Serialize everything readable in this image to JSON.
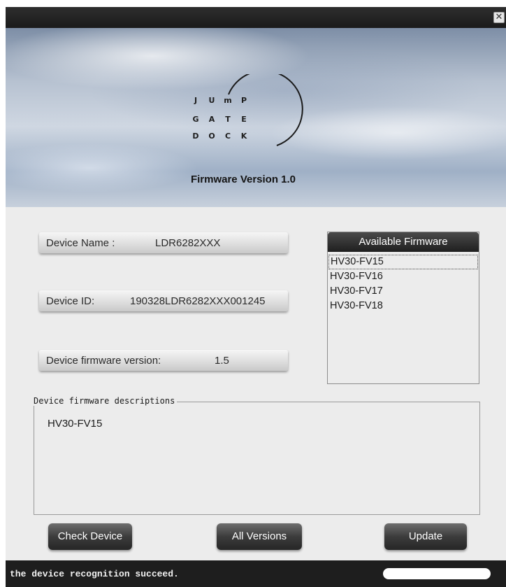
{
  "window": {
    "close_glyph": "✕"
  },
  "banner": {
    "logo_letters": [
      [
        "J",
        "U",
        "m",
        "P"
      ],
      [
        "G",
        "A",
        "T",
        "E"
      ],
      [
        "D",
        "O",
        "C",
        "K"
      ]
    ],
    "firmware_version": "Firmware Version 1.0"
  },
  "device": {
    "name_label": "Device Name :",
    "name_value": "LDR6282XXX",
    "id_label": "Device ID:",
    "id_value": "190328LDR6282XXX001245",
    "fw_label": "Device firmware version:",
    "fw_value": "1.5"
  },
  "firmware_panel": {
    "header": "Available Firmware",
    "items": [
      "HV30-FV15",
      "HV30-FV16",
      "HV30-FV17",
      "HV30-FV18"
    ],
    "selected_index": 0
  },
  "description": {
    "legend": "Device firmware descriptions",
    "text": "HV30-FV15"
  },
  "buttons": {
    "check": "Check Device",
    "all_versions": "All Versions",
    "update": "Update"
  },
  "status": {
    "text": "the device recognition succeed.",
    "progress": 0
  }
}
